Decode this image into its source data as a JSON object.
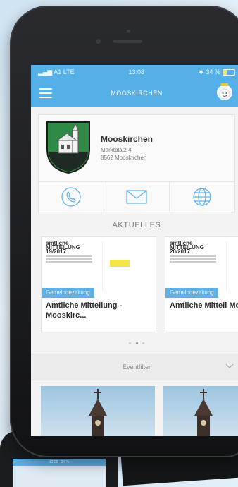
{
  "status_bar": {
    "carrier": "A1 LTE",
    "time": "13:08",
    "battery": "34 %",
    "battery_level": 0.34
  },
  "nav": {
    "title": "MOOSKIRCHEN"
  },
  "municipality": {
    "name": "Mooskirchen",
    "street": "Marktplatz 4",
    "city": "8562 Mooskirchen"
  },
  "actions": {
    "phone": "phone-icon",
    "mail": "mail-icon",
    "web": "globe-icon"
  },
  "news": {
    "section_title": "AKTUELLES",
    "items": [
      {
        "title": "Amtliche Mitteilung - Mooskirc...",
        "category": "Gemeindezeitung",
        "doc_heading": "amtliche MITTEILUNG",
        "doc_issue": "19/2017"
      },
      {
        "title": "Amtliche Mitteil Mooskirc...",
        "category": "Gemeindezeitung",
        "doc_heading": "amtliche MITTEILUNG",
        "doc_issue": "20/2017"
      }
    ],
    "page_count": 3,
    "active_page": 1
  },
  "event_filter": {
    "label": "Eventfilter"
  },
  "background_phone": {
    "time": "13:08",
    "battery": "34 %"
  },
  "colors": {
    "primary": "#55b0e8",
    "tag": "#5fb0e6",
    "coat_green": "#2f8a45"
  }
}
